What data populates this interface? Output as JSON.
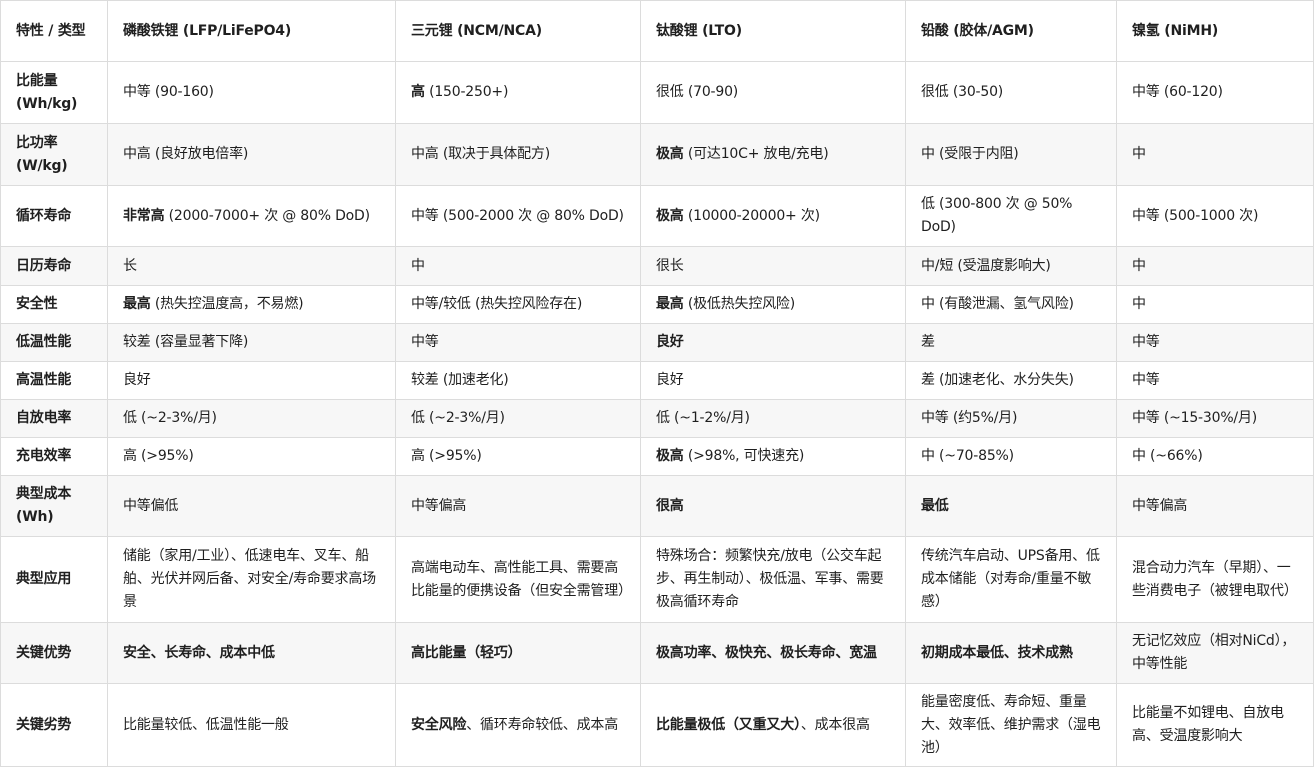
{
  "table": {
    "header": [
      "特性 / 类型",
      "磷酸铁锂 (LFP/LiFePO4)",
      "三元锂 (NCM/NCA)",
      "钛酸锂 (LTO)",
      "铅酸 (胶体/AGM)",
      "镍氢 (NiMH)"
    ],
    "rows": [
      {
        "label": "比能量 (Wh/kg)",
        "cells": [
          {
            "b": "",
            "t": "中等 (90-160)"
          },
          {
            "b": "高",
            "t": " (150-250+)"
          },
          {
            "b": "",
            "t": "很低 (70-90)"
          },
          {
            "b": "",
            "t": "很低 (30-50)"
          },
          {
            "b": "",
            "t": "中等 (60-120)"
          }
        ]
      },
      {
        "label": "比功率 (W/kg)",
        "cells": [
          {
            "b": "",
            "t": "中高 (良好放电倍率)"
          },
          {
            "b": "",
            "t": "中高 (取决于具体配方)"
          },
          {
            "b": "极高",
            "t": " (可达10C+ 放电/充电)"
          },
          {
            "b": "",
            "t": "中 (受限于内阻)"
          },
          {
            "b": "",
            "t": "中"
          }
        ]
      },
      {
        "label": "循环寿命",
        "cells": [
          {
            "b": "非常高",
            "t": " (2000-7000+ 次 @ 80% DoD)"
          },
          {
            "b": "",
            "t": "中等 (500-2000 次 @ 80% DoD)"
          },
          {
            "b": "极高",
            "t": " (10000-20000+ 次)"
          },
          {
            "b": "",
            "t": "低 (300-800 次 @ 50% DoD)"
          },
          {
            "b": "",
            "t": "中等 (500-1000 次)"
          }
        ]
      },
      {
        "label": "日历寿命",
        "cells": [
          {
            "b": "",
            "t": "长"
          },
          {
            "b": "",
            "t": "中"
          },
          {
            "b": "",
            "t": "很长"
          },
          {
            "b": "",
            "t": "中/短 (受温度影响大)"
          },
          {
            "b": "",
            "t": "中"
          }
        ]
      },
      {
        "label": "安全性",
        "cells": [
          {
            "b": "最高",
            "t": " (热失控温度高，不易燃)"
          },
          {
            "b": "",
            "t": "中等/较低 (热失控风险存在)"
          },
          {
            "b": "最高",
            "t": " (极低热失控风险)"
          },
          {
            "b": "",
            "t": "中 (有酸泄漏、氢气风险)"
          },
          {
            "b": "",
            "t": "中"
          }
        ]
      },
      {
        "label": "低温性能",
        "cells": [
          {
            "b": "",
            "t": "较差 (容量显著下降)"
          },
          {
            "b": "",
            "t": "中等"
          },
          {
            "b": "良好",
            "t": ""
          },
          {
            "b": "",
            "t": "差"
          },
          {
            "b": "",
            "t": "中等"
          }
        ]
      },
      {
        "label": "高温性能",
        "cells": [
          {
            "b": "",
            "t": "良好"
          },
          {
            "b": "",
            "t": "较差 (加速老化)"
          },
          {
            "b": "",
            "t": "良好"
          },
          {
            "b": "",
            "t": "差 (加速老化、水分失失)"
          },
          {
            "b": "",
            "t": "中等"
          }
        ]
      },
      {
        "label": "自放电率",
        "cells": [
          {
            "b": "",
            "t": "低 (~2-3%/月)"
          },
          {
            "b": "",
            "t": "低 (~2-3%/月)"
          },
          {
            "b": "",
            "t": "低 (~1-2%/月)"
          },
          {
            "b": "",
            "t": "中等 (约5%/月)"
          },
          {
            "b": "",
            "t": "中等 (~15-30%/月)"
          }
        ]
      },
      {
        "label": "充电效率",
        "cells": [
          {
            "b": "",
            "t": "高 (>95%)"
          },
          {
            "b": "",
            "t": "高 (>95%)"
          },
          {
            "b": "极高",
            "t": " (>98%, 可快速充)"
          },
          {
            "b": "",
            "t": "中 (~70-85%)"
          },
          {
            "b": "",
            "t": "中 (~66%)"
          }
        ]
      },
      {
        "label": "典型成本 (Wh)",
        "cells": [
          {
            "b": "",
            "t": "中等偏低"
          },
          {
            "b": "",
            "t": "中等偏高"
          },
          {
            "b": "很高",
            "t": ""
          },
          {
            "b": "最低",
            "t": ""
          },
          {
            "b": "",
            "t": "中等偏高"
          }
        ]
      },
      {
        "label": "典型应用",
        "cells": [
          {
            "b": "",
            "t": "储能（家用/工业）、低速电车、叉车、船舶、光伏并网后备、对安全/寿命要求高场景"
          },
          {
            "b": "",
            "t": "高端电动车、高性能工具、需要高比能量的便携设备（但安全需管理）"
          },
          {
            "b": "",
            "t": "特殊场合：频繁快充/放电（公交车起步、再生制动）、极低温、军事、需要极高循环寿命"
          },
          {
            "b": "",
            "t": "传统汽车启动、UPS备用、低成本储能（对寿命/重量不敏感）"
          },
          {
            "b": "",
            "t": "混合动力汽车（早期）、一些消费电子（被锂电取代）"
          }
        ]
      },
      {
        "label": "关键优势",
        "cells": [
          {
            "b": "安全、长寿命、成本中低",
            "t": ""
          },
          {
            "b": "高比能量（轻巧）",
            "t": ""
          },
          {
            "b": "极高功率、极快充、极长寿命、宽温",
            "t": ""
          },
          {
            "b": "初期成本最低、技术成熟",
            "t": ""
          },
          {
            "b": "",
            "t": "无记忆效应（相对NiCd），中等性能"
          }
        ]
      },
      {
        "label": "关键劣势",
        "cells": [
          {
            "b": "",
            "t": "比能量较低、低温性能一般"
          },
          {
            "b": "安全风险",
            "t": "、循环寿命较低、成本高"
          },
          {
            "b": "比能量极低（又重又大）",
            "t": "、成本很高"
          },
          {
            "b": "",
            "t": "能量密度低、寿命短、重量大、效率低、维护需求（湿电池）"
          },
          {
            "b": "",
            "t": "比能量不如锂电、自放电高、受温度影响大"
          }
        ]
      }
    ]
  }
}
